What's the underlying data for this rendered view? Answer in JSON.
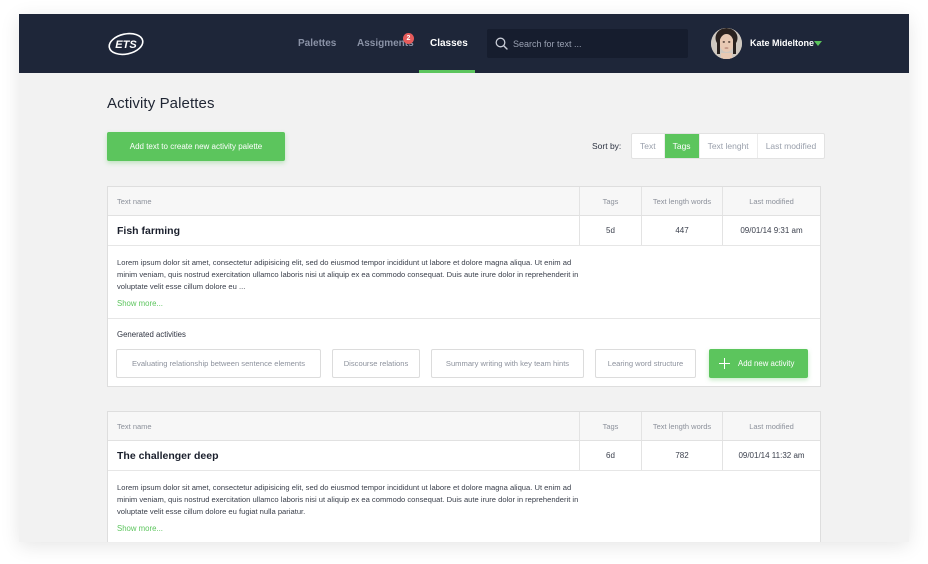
{
  "header": {
    "logo_text": "ETS",
    "nav": [
      {
        "label": "Palettes",
        "active": false
      },
      {
        "label": "Assigments",
        "active": false,
        "badge": "2"
      },
      {
        "label": "Classes",
        "active": true
      }
    ],
    "search_placeholder": "Search for text ...",
    "user_name": "Kate Mideltone"
  },
  "page": {
    "title": "Activity Palettes",
    "add_button": "Add text to create new activity palette",
    "sort_label": "Sort by:",
    "sort_options": [
      "Text",
      "Tags",
      "Text lenght",
      "Last modified"
    ],
    "sort_active": "Tags"
  },
  "columns": {
    "name": "Text name",
    "tags": "Tags",
    "length": "Text length words",
    "modified": "Last modified"
  },
  "cards": [
    {
      "title": "Fish farming",
      "tags": "5d",
      "length": "447",
      "modified": "09/01/14 9:31 am",
      "description": "Lorem ipsum dolor sit amet, consectetur adipisicing elit, sed do eiusmod tempor incididunt ut labore et dolore magna aliqua. Ut enim ad minim veniam, quis nostrud exercitation ullamco laboris nisi ut aliquip ex ea commodo consequat. Duis aute irure dolor in reprehenderit in voluptate velit esse cillum dolore eu ...",
      "show_more": "Show more...",
      "generated_label": "Generated activities",
      "activities": [
        "Evaluating relationship between sentence elements",
        "Discourse relations",
        "Summary writing with key team hints",
        "Learing word structure"
      ],
      "add_activity": "Add new activity"
    },
    {
      "title": "The challenger deep",
      "tags": "6d",
      "length": "782",
      "modified": "09/01/14 11:32 am",
      "description": "Lorem ipsum dolor sit amet, consectetur adipisicing elit, sed do eiusmod tempor incididunt ut labore et dolore magna aliqua. Ut enim ad minim veniam, quis nostrud exercitation ullamco laboris nisi ut aliquip ex ea commodo consequat. Duis aute irure dolor in reprehenderit in voluptate velit esse cillum dolore eu fugiat nulla pariatur.",
      "show_more": "Show more..."
    }
  ],
  "colors": {
    "navbar": "#1e2639",
    "accent": "#5cc55d",
    "badge": "#e55b5b",
    "background": "#f2f2f2"
  },
  "icons": {
    "search": "search-icon",
    "user_dropdown": "caret-down-icon",
    "add": "plus-icon"
  }
}
